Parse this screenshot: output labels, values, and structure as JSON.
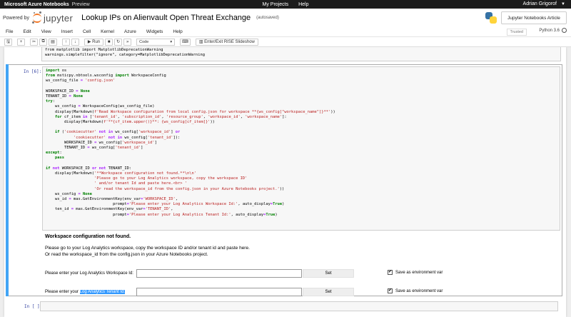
{
  "topbar": {
    "brand": "Microsoft Azure Notebooks",
    "preview": "Preview",
    "nav": [
      "My Projects",
      "Help"
    ],
    "user": "Adrian Grigorof"
  },
  "header": {
    "powered_by": "Powered by",
    "logo_text": "jupyter",
    "notebook_title": "Lookup IPs on Alienvault Open Threat Exchange",
    "save_status": "(autosaved)",
    "article_button": "Jupyter Notebooks Article"
  },
  "menubar": {
    "items": [
      "File",
      "Edit",
      "View",
      "Insert",
      "Cell",
      "Kernel",
      "Azure",
      "Widgets",
      "Help"
    ],
    "trusted": "Trusted",
    "kernel": "Python 3.6"
  },
  "toolbar": {
    "run_label": "▶ Run",
    "cell_type": "Code",
    "slideshow_label": "Enter/Exit RISE Slideshow"
  },
  "prev_cell": {
    "lines": [
      "from matplotlib import MatplotlibDeprecationWarning",
      "warnings.simplefilter(\"ignore\", category=MatplotlibDeprecationWarning"
    ]
  },
  "cell6": {
    "prompt": "In [6]:",
    "output": {
      "heading": "Workspace configuration not found.",
      "line1": "Please go to your Log Analytics workspace, copy the workspace ID and/or tenant id and paste here.",
      "line2": "Or read the workspace_id from the config.json in your Azure Notebooks project.",
      "row1_label": "Please enter your Log Analytics Workspace Id:",
      "row2_label_pre": "Please enter your ",
      "row2_label_sel": "Log Analytics Tenant Id:",
      "set_label": "Set",
      "check_mark": "✔",
      "checkbox_label": "Save as environment var"
    }
  },
  "empty_cell": {
    "prompt": "In [ ]:"
  }
}
